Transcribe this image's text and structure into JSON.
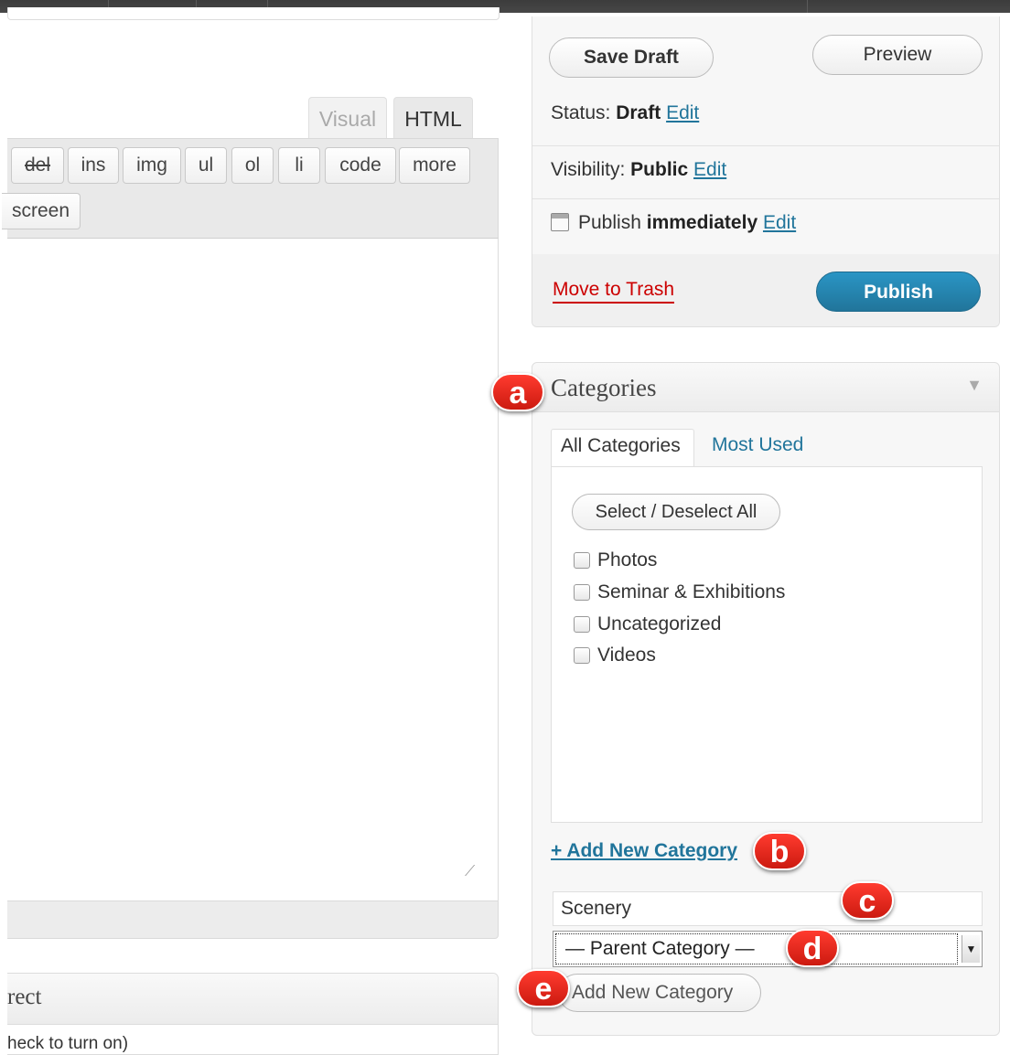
{
  "editor": {
    "tabs": {
      "visual": "Visual",
      "html": "HTML"
    },
    "quicktags": [
      "del",
      "ins",
      "img",
      "ul",
      "ol",
      "li",
      "code",
      "more"
    ],
    "fullscreen_label": "screen",
    "lower_box_title": "rect",
    "lower_box_text": "heck to turn on)"
  },
  "publish": {
    "save_draft": "Save Draft",
    "preview": "Preview",
    "status_label": "Status:",
    "status_value": "Draft",
    "visibility_label": "Visibility:",
    "visibility_value": "Public",
    "publish_label": "Publish",
    "publish_value": "immediately",
    "edit": "Edit",
    "move_to_trash": "Move to Trash",
    "publish_button": "Publish"
  },
  "categories": {
    "title": "Categories",
    "tabs": {
      "all": "All Categories",
      "most_used": "Most Used"
    },
    "select_all": "Select / Deselect All",
    "items": [
      "Photos",
      "Seminar & Exhibitions",
      "Uncategorized",
      "Videos"
    ],
    "add_new_link": "+ Add New Category",
    "new_category_value": "Scenery",
    "parent_select_value": "— Parent Category —",
    "add_button": "Add New Category"
  },
  "callouts": [
    "a",
    "b",
    "c",
    "d",
    "e"
  ],
  "colors": {
    "link": "#21759b",
    "publish_button": "#21759b",
    "trash": "#cc0000",
    "callout": "#e0261b"
  }
}
